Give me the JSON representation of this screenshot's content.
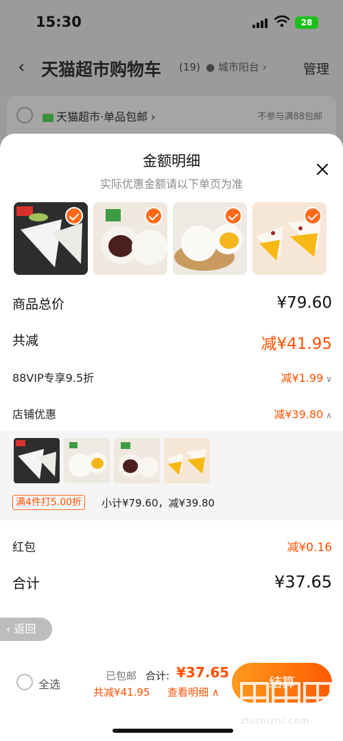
{
  "status_bar": {
    "time": "15:30",
    "battery": "28"
  },
  "page_header": {
    "title": "天猫超市购物车",
    "count": "(19)",
    "location": "城市阳台",
    "manage": "管理"
  },
  "store_row": {
    "store_name": "天猫超市·单品包邮",
    "note": "不参与满88包邮"
  },
  "sheet": {
    "title": "金额明细",
    "subtitle": "实际优惠金额请以下单页为准",
    "items": [
      {
        "name": "milk-triangle-cake"
      },
      {
        "name": "red-bean-bun"
      },
      {
        "name": "custard-bun"
      },
      {
        "name": "mango-glutinous-cake"
      }
    ],
    "rows": {
      "total_label": "商品总价",
      "total_value": "¥79.60",
      "reduce_label": "共减",
      "reduce_value": "减¥41.95",
      "vip_label": "88VIP专享9.5折",
      "vip_value": "减¥1.99",
      "shop_label": "店铺优惠",
      "shop_value": "减¥39.80",
      "redpack_label": "红包",
      "redpack_value": "减¥0.16",
      "sum_label": "合计",
      "sum_value": "¥37.65"
    },
    "shop_promo": {
      "tag": "满4件打5.00折",
      "summary": "小计¥79.60，减¥39.80"
    }
  },
  "back_button": "返回",
  "bottom_bar": {
    "select_all": "全选",
    "free_shipping": "已包邮",
    "sum_label": "合计:",
    "sum_value": "¥37.65",
    "save_text": "共减¥41.95",
    "detail_link": "查看明细",
    "checkout": "结算"
  },
  "watermark": "zhizhizhi.com",
  "colors": {
    "accent": "#ff5000",
    "checkout_start": "#ff9a1e",
    "checkout_end": "#ff5a00"
  }
}
